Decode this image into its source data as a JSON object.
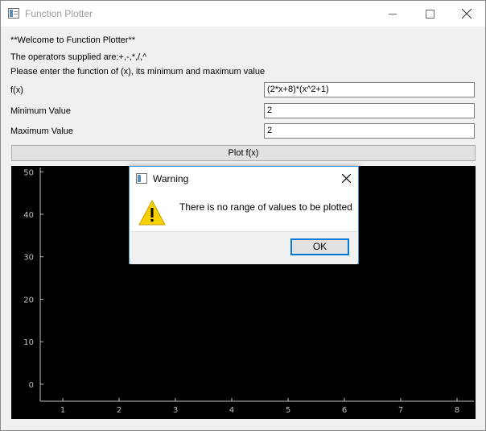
{
  "window": {
    "title": "Function Plotter"
  },
  "intro": {
    "welcome": "**Welcome to Function Plotter**",
    "operators": "The operators supplied are:+,-,*,/,^",
    "instructions": "Please enter the function of (x), its minimum and maximum value"
  },
  "form": {
    "fx_label": "f(x)",
    "fx_value": "(2*x+8)*(x^2+1)",
    "min_label": "Minimum Value",
    "min_value": "2",
    "max_label": "Maximum Value",
    "max_value": "2",
    "plot_button": "Plot f(x)"
  },
  "chart_data": {
    "type": "line",
    "series": [],
    "x_ticks": [
      "1",
      "2",
      "3",
      "4",
      "5",
      "6",
      "7",
      "8"
    ],
    "y_ticks": [
      "0",
      "10",
      "20",
      "30",
      "40",
      "50"
    ],
    "xlim": [
      0.6,
      8.3
    ],
    "ylim": [
      -4,
      51
    ],
    "background": "#000000",
    "axis_color": "#bfbfbf"
  },
  "dialog": {
    "title": "Warning",
    "message": "There is no range of values to be plotted",
    "ok_label": "OK",
    "icon": "warning-triangle-icon"
  }
}
